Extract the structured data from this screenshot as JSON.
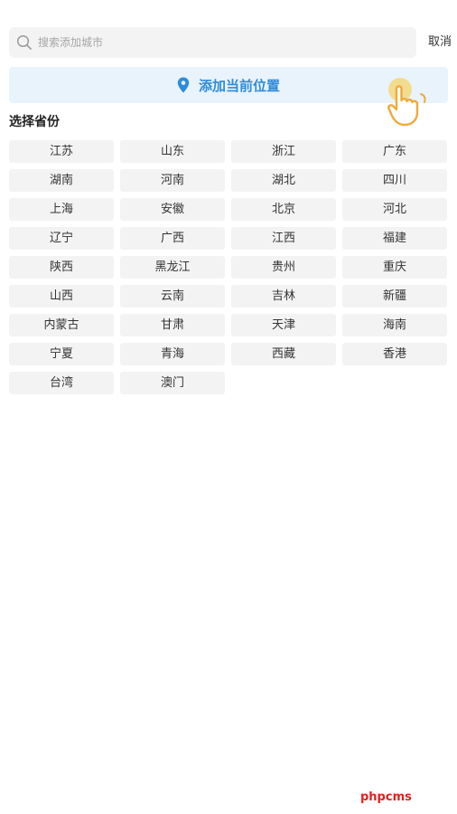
{
  "search": {
    "placeholder": "搜索添加城市",
    "value": ""
  },
  "header": {
    "cancel_label": "取消"
  },
  "locate": {
    "label": "添加当前位置",
    "icon": "location-pin-icon",
    "accent_color": "#2f8bd8",
    "background_color": "#e8f3fc"
  },
  "section": {
    "title": "选择省份"
  },
  "provinces": [
    "江苏",
    "山东",
    "浙江",
    "广东",
    "湖南",
    "河南",
    "湖北",
    "四川",
    "上海",
    "安徽",
    "北京",
    "河北",
    "辽宁",
    "广西",
    "江西",
    "福建",
    "陕西",
    "黑龙江",
    "贵州",
    "重庆",
    "山西",
    "云南",
    "吉林",
    "新疆",
    "内蒙古",
    "甘肃",
    "天津",
    "海南",
    "宁夏",
    "青海",
    "西藏",
    "香港",
    "台湾",
    "澳门"
  ],
  "watermark": {
    "text": "phpcms",
    "color": "#e02020"
  }
}
